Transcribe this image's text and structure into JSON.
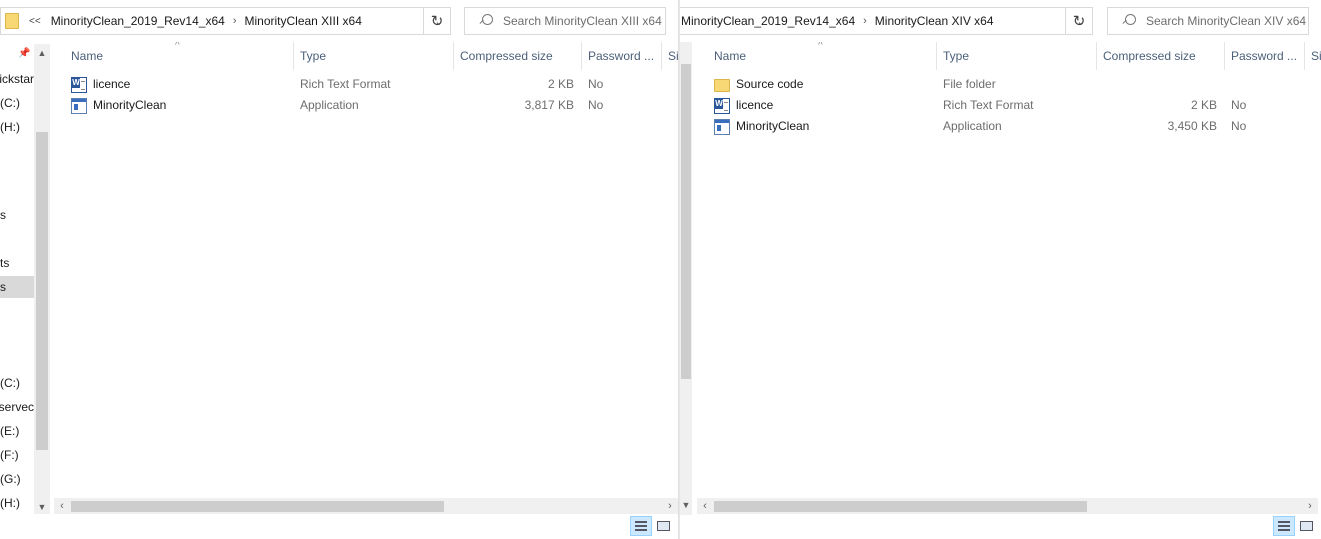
{
  "left": {
    "breadcrumb": {
      "overflow": "<<",
      "path": [
        "MinorityClean_2019_Rev14_x64",
        "MinorityClean XIII x64"
      ]
    },
    "search_placeholder": "Search MinorityClean XIII x64",
    "nav_items": [
      {
        "label": "uickstar",
        "icon": "quick-access-icon"
      },
      {
        "label": "(C:)",
        "icon": "drive-icon"
      },
      {
        "label": "(H:)",
        "icon": "drive-icon"
      },
      {
        "label": "s",
        "icon": "folder-icon"
      },
      {
        "label": "ts",
        "icon": "folder-icon"
      },
      {
        "label": "s",
        "icon": "folder-icon",
        "selected": true
      },
      {
        "label": "(C:)",
        "icon": "drive-icon"
      },
      {
        "label": "eservec",
        "icon": "drive-icon"
      },
      {
        "label": "(E:)",
        "icon": "drive-icon"
      },
      {
        "label": "(F:)",
        "icon": "drive-icon"
      },
      {
        "label": "(G:)",
        "icon": "drive-icon"
      },
      {
        "label": "(H:)",
        "icon": "drive-icon"
      }
    ],
    "columns": [
      "Name",
      "Type",
      "Compressed size",
      "Password ...",
      "Si"
    ],
    "files": [
      {
        "name": "licence",
        "type": "Rich Text Format",
        "size": "2 KB",
        "password": "No",
        "icon": "rtf-document-icon"
      },
      {
        "name": "MinorityClean",
        "type": "Application",
        "size": "3,817 KB",
        "password": "No",
        "icon": "application-icon"
      }
    ]
  },
  "right": {
    "breadcrumb": {
      "path": [
        "MinorityClean_2019_Rev14_x64",
        "MinorityClean XIV x64"
      ]
    },
    "search_placeholder": "Search MinorityClean XIV x64",
    "columns": [
      "Name",
      "Type",
      "Compressed size",
      "Password ...",
      "Si"
    ],
    "files": [
      {
        "name": "Source code",
        "type": "File folder",
        "size": "",
        "password": "",
        "icon": "folder-icon"
      },
      {
        "name": "licence",
        "type": "Rich Text Format",
        "size": "2 KB",
        "password": "No",
        "icon": "rtf-document-icon"
      },
      {
        "name": "MinorityClean",
        "type": "Application",
        "size": "3,450 KB",
        "password": "No",
        "icon": "application-icon"
      }
    ]
  },
  "icons": {
    "refresh": "refresh-icon",
    "search": "search-icon",
    "dropdown": "chevron-down-icon",
    "details_view": "details-view-icon",
    "large_icons_view": "large-icons-view-icon",
    "pin": "pin-icon"
  }
}
